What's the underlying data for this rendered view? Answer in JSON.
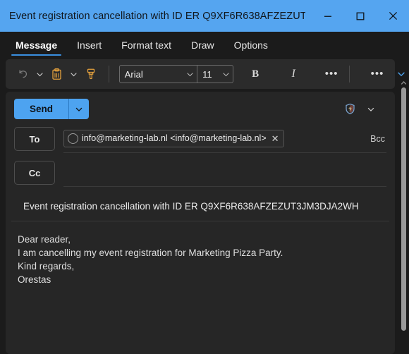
{
  "window": {
    "title": "Event registration cancellation with ID ER Q9XF6R638AFZEZUT3J...",
    "controls": {
      "minimize": "minimize-icon",
      "maximize": "maximize-icon",
      "close": "close-icon"
    },
    "colors": {
      "titlebar": "#55a5f0",
      "accent": "#4da3f0",
      "tab_underline": "#3a8fe0",
      "panel": "#262626",
      "app_background": "#1b1b1b",
      "toolbar": "#2b2b2b",
      "icon_orange": "#e8a33d"
    }
  },
  "ribbon": {
    "tabs": [
      {
        "label": "Message",
        "active": true
      },
      {
        "label": "Insert",
        "active": false
      },
      {
        "label": "Format text",
        "active": false
      },
      {
        "label": "Draw",
        "active": false
      },
      {
        "label": "Options",
        "active": false
      }
    ],
    "toolbar": {
      "undo": "undo-icon",
      "undo_chevron": "chevron-down-icon",
      "paste": "paste-icon",
      "paste_chevron": "chevron-down-icon",
      "format_painter": "format-painter-icon",
      "font_name": "Arial",
      "font_size": "11",
      "bold": "B",
      "italic": "I",
      "more_formatting": "•••",
      "more_commands": "•••",
      "expand": "chevron-down-icon"
    }
  },
  "compose": {
    "send_label": "Send",
    "send_chevron": "chevron-down-icon",
    "sensitivity_icon": "shield-question-icon",
    "sensitivity_chevron": "chevron-down-icon",
    "to_label": "To",
    "cc_label": "Cc",
    "bcc_label": "Bcc",
    "recipients": [
      {
        "display": "info@marketing-lab.nl <info@marketing-lab.nl>",
        "avatar": "contact-avatar-icon",
        "remove": "✕"
      }
    ],
    "cc_recipients": [],
    "subject": "Event registration cancellation with ID ER Q9XF6R638AFZEZUT3JM3DJA2WH",
    "body_lines": [
      "Dear reader,",
      "I am cancelling my event registration for Marketing Pizza Party.",
      "Kind regards,",
      "Orestas"
    ]
  },
  "scrollbar": {
    "up_arrow": "chevron-up-icon"
  }
}
